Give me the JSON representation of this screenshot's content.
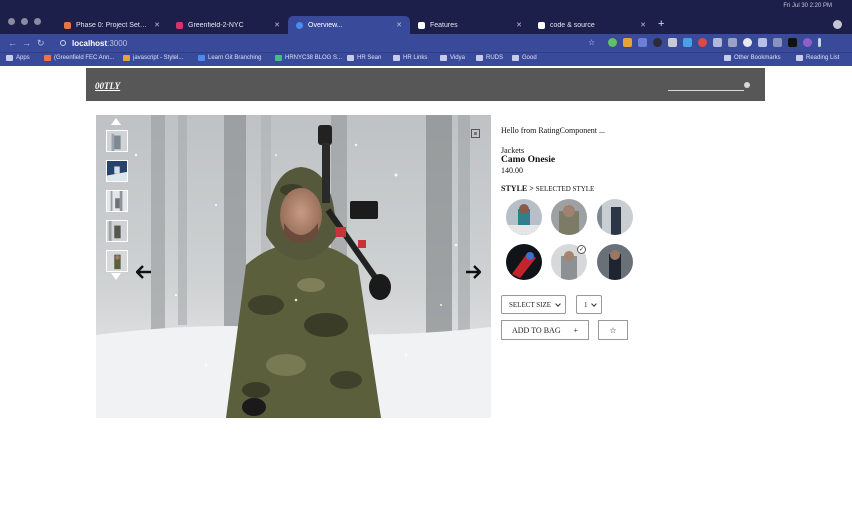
{
  "browser": {
    "system_clock": "Fri Jul 30  2:20 PM",
    "tabs": [
      {
        "title": "Phase 0: Project Setup and Re",
        "active": false,
        "color": "#e8744a"
      },
      {
        "title": "Greenfield-2-NYC",
        "active": false,
        "color": "#d6336c"
      },
      {
        "title": "Overview...",
        "active": true,
        "color": "#4a8cf0"
      },
      {
        "title": "Features",
        "active": false,
        "color": "#ffffff"
      },
      {
        "title": "code & source",
        "active": false,
        "color": "#ffffff"
      }
    ],
    "url_host": "localhost",
    "url_port": ":3000",
    "bookmarks": [
      {
        "label": "Apps"
      },
      {
        "label": "(Greenfield FEC Ann..."
      },
      {
        "label": "javascript - Stylel..."
      },
      {
        "label": "Learn Git Branching"
      },
      {
        "label": "HRNYC38 BLOG S..."
      },
      {
        "label": "HR Sean"
      },
      {
        "label": "HR Links"
      },
      {
        "label": "Vidya"
      },
      {
        "label": "RUDS"
      },
      {
        "label": "Good"
      },
      {
        "label": "Other Bookmarks"
      },
      {
        "label": "Reading List"
      }
    ]
  },
  "site": {
    "logo": "00TLY"
  },
  "gallery": {
    "thumbnail_count": 5,
    "selected_thumbnail": 5
  },
  "product": {
    "rating_text": "Hello from RatingComponent ...",
    "category": "Jackets",
    "name": "Camo Onesie",
    "price": "140.00",
    "style_label": "STYLE >",
    "selected_style": "SELECTED STYLE",
    "styles_count": 6,
    "selected_style_index": 5
  },
  "controls": {
    "size_select": "SELECT SIZE",
    "quantity": "1",
    "add_to_bag": "ADD TO BAG",
    "add_plus": "+",
    "favorite_star": "☆"
  }
}
